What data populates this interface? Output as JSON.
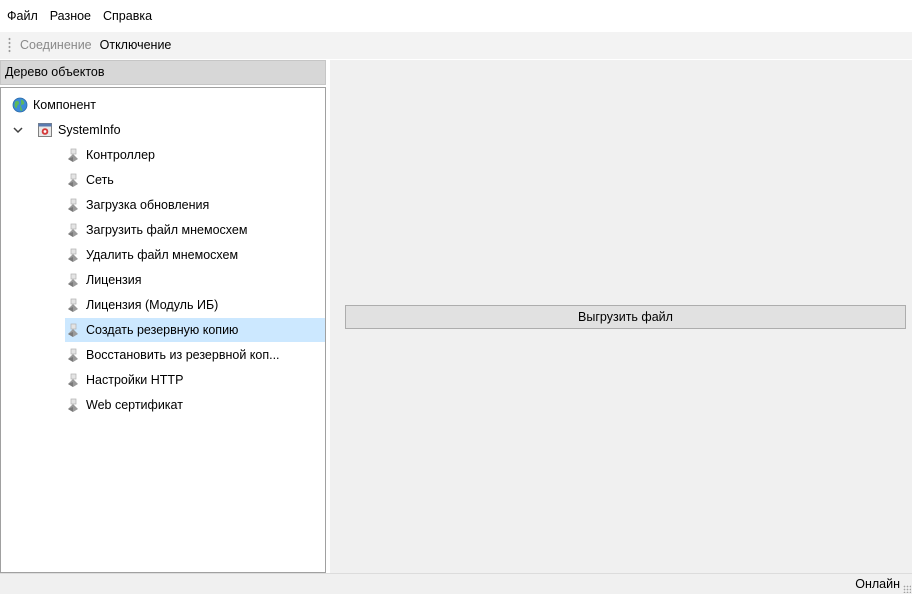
{
  "menu": [
    "Файл",
    "Разное",
    "Справка"
  ],
  "toolbar": {
    "connect_label": "Соединение",
    "disconnect_label": "Отключение"
  },
  "tree": {
    "header": "Дерево объектов",
    "root_component": "Компонент",
    "system_node": "SystemInfo",
    "items": [
      "Контроллер",
      "Сеть",
      "Загрузка обновления",
      "Загрузить файл мнемосхем",
      "Удалить файл мнемосхем",
      "Лицензия",
      "Лицензия (Модуль ИБ)",
      "Создать резервную копию",
      "Восстановить из резервной коп...",
      "Настройки HTTP",
      "Web сертификат"
    ],
    "selected_index": 7
  },
  "main": {
    "export_button_label": "Выгрузить файл"
  },
  "status": {
    "connection_state": "Онлайн"
  },
  "colors": {
    "selection": "#cce8ff",
    "panel_bg": "#f0f0f0",
    "header_bg": "#d7d7d7"
  },
  "icons": {
    "component": "globe-icon",
    "system": "system-module-icon",
    "item": "gear-node-icon",
    "expander": "chevron-down-icon"
  }
}
